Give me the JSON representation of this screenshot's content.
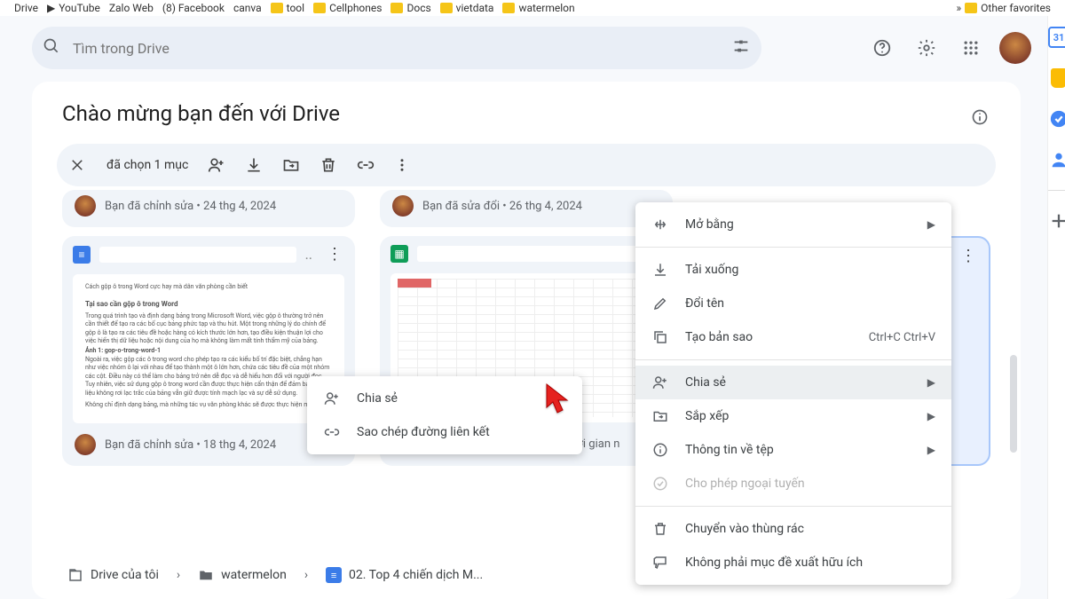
{
  "bookmarks": {
    "items": [
      "Drive",
      "YouTube",
      "Zalo Web",
      "(8) Facebook",
      "canva",
      "tool",
      "Cellphones",
      "Docs",
      "vietdata",
      "watermelon"
    ],
    "overflow": "Other favorites"
  },
  "search": {
    "placeholder": "Tìm trong Drive"
  },
  "header": {
    "title": "Chào mừng bạn đến với Drive"
  },
  "selection": {
    "label": "đã chọn 1 mục"
  },
  "cards_top": {
    "a": {
      "subtitle": "Bạn đã chỉnh sửa • 24 thg 4, 2024"
    },
    "b": {
      "subtitle": "Bạn đã sửa đổi • 26 thg 4, 2024"
    }
  },
  "word_preview": {
    "l1": "Cách gộp ô trong Word cực hay mà dân văn phòng cần biết",
    "h1": "Tại sao cần gộp ô trong Word",
    "p1": "Trong quá trình tạo và định dạng bảng trong Microsoft Word, việc gộp ô thường trở nên cần thiết để tạo ra các bố cục bảng phức tạp và thu hút. Một trong những lý do chính để gộp ô là tạo ra các tiêu đề hoặc hàng có kích thước lớn hơn, tạo điều kiện thuận lợi cho việc hiển thị dữ liệu hoặc nội dung của họ mà không làm mất tính thẩm mỹ của bảng.",
    "b1": "Ảnh 1: gop-o-trong-word-1",
    "p2": "Ngoài ra, việc gộp các ô trong word cho phép tạo ra các kiểu bố trí đặc biệt, chẳng hạn như việc nhóm ô lại với nhau để tạo thành một ô lớn hơn, chứa các tiêu đề của một nhóm các cột. Điều này có thể làm cho bảng trở nên dễ đọc và dễ hiểu hơn đối với người đọc. Tuy nhiên, việc sử dụng gộp ô trong word cần được thực hiện cẩn thận để đảm bảo dữ liệu không rơi lạc trắc của bảng vẫn giữ được tính mạch lạc và sự dễ sử dụng.",
    "p3": "Không chỉ định dạng bảng, mà những tác vụ văn phòng khác sẽ được thực hiện một"
  },
  "cards_bottom": {
    "a": {
      "subtitle": "Bạn đã chỉnh sửa • 18 thg 4, 2024"
    },
    "b": {
      "subtitle": "Bạn thường mở vào khoảng thời gian n"
    }
  },
  "breadcrumb": {
    "root": "Drive của tôi",
    "folder": "watermelon",
    "file": "02. Top 4 chiến dịch M..."
  },
  "submenu": {
    "share": "Chia sẻ",
    "copylink": "Sao chép đường liên kết"
  },
  "context": {
    "openwith": "Mở bằng",
    "download": "Tải xuống",
    "rename": "Đổi tên",
    "makecopy": "Tạo bản sao",
    "makecopy_sc": "Ctrl+C Ctrl+V",
    "share": "Chia sẻ",
    "organize": "Sắp xếp",
    "fileinfo": "Thông tin về tệp",
    "offline": "Cho phép ngoại tuyến",
    "trash": "Chuyển vào thùng rác",
    "notsuggest": "Không phải mục đề xuất hữu ích"
  },
  "side_calendar": "31"
}
